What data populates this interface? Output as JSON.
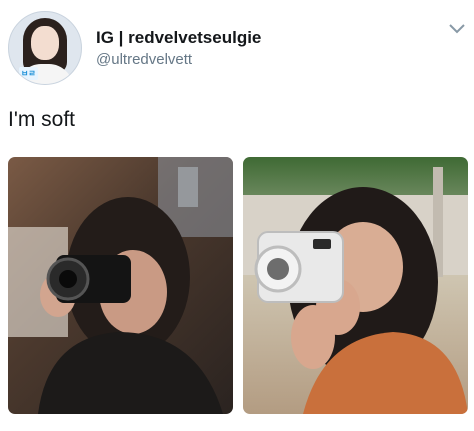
{
  "tweet": {
    "display_name": "IG | redvelvetseulgie",
    "handle": "@ultredvelvett",
    "text": "I'm soft",
    "avatar_logo_text": "ㅂㄹ",
    "menu_icon": "chevron-down-icon",
    "images": [
      {
        "name": "photo-camera-left",
        "accent": "#2a2320"
      },
      {
        "name": "photo-camera-right",
        "accent": "#d9d9d9"
      }
    ]
  }
}
